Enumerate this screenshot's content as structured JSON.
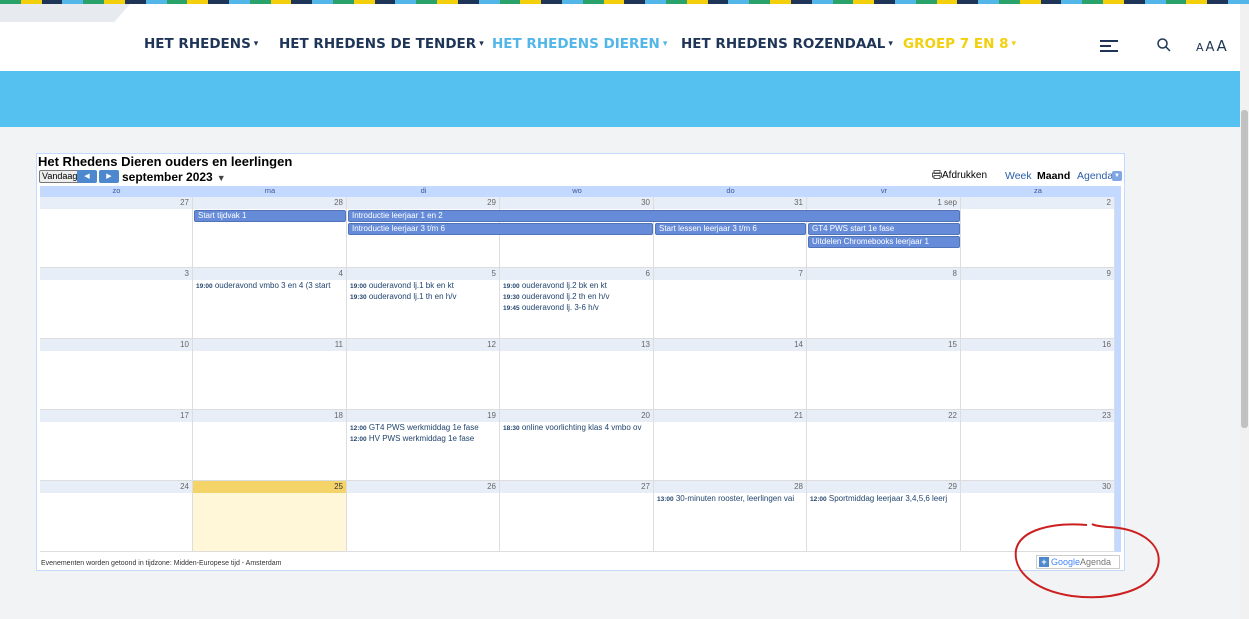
{
  "stripe_colors": [
    "#29a36a",
    "#f4d00c",
    "#1f3557",
    "#52b6e9"
  ],
  "nav": {
    "items": [
      {
        "label": "HET RHEDENS",
        "caret": "▾"
      },
      {
        "label": "HET RHEDENS DE TENDER",
        "caret": "▾"
      },
      {
        "label": "HET RHEDENS DIEREN",
        "caret": "▾"
      },
      {
        "label": "HET RHEDENS ROZENDAAL",
        "caret": "▾"
      },
      {
        "label": "GROEP 7 EN 8",
        "caret": "▾"
      }
    ],
    "active_color": "#52b6e9",
    "aaa": [
      "A",
      "A",
      "A"
    ]
  },
  "banner_color": "#55c1f0",
  "calendar": {
    "title": "Het Rhedens Dieren ouders en leerlingen",
    "today_label": "Vandaag",
    "prev_icon": "◀",
    "next_icon": "▶",
    "month": "september 2023",
    "month_dd": "▼",
    "print_label": "Afdrukken",
    "views": [
      "Week",
      "Maand",
      "Agenda"
    ],
    "selected_view": "Maand",
    "day_names": [
      "zo",
      "ma",
      "di",
      "wo",
      "do",
      "vr",
      "za"
    ],
    "weeks": [
      [
        "27",
        "28",
        "29",
        "30",
        "31",
        "1 sep",
        "2"
      ],
      [
        "3",
        "4",
        "5",
        "6",
        "7",
        "8",
        "9"
      ],
      [
        "10",
        "11",
        "12",
        "13",
        "14",
        "15",
        "16"
      ],
      [
        "17",
        "18",
        "19",
        "20",
        "21",
        "22",
        "23"
      ],
      [
        "24",
        "25",
        "26",
        "27",
        "28",
        "29",
        "30"
      ]
    ],
    "today": "25",
    "multi_day_events": [
      {
        "title": "Start tijdvak 1"
      },
      {
        "title": "Introductie leerjaar 1 en 2"
      },
      {
        "title": "Introductie leerjaar 3 t/m 6"
      },
      {
        "title": "Start lessen leerjaar 3 t/m 6"
      },
      {
        "title": "GT4 PWS start 1e fase"
      },
      {
        "title": "Uitdelen Chromebooks leerjaar 1"
      }
    ],
    "timed_events": [
      {
        "time": "19:00",
        "title": "ouderavond vmbo 3 en 4 (3 start"
      },
      {
        "time": "19:00",
        "title": "ouderavond lj.1 bk en kt"
      },
      {
        "time": "19:30",
        "title": "ouderavond lj.1 th en h/v"
      },
      {
        "time": "19:00",
        "title": "ouderavond lj.2 bk en kt"
      },
      {
        "time": "19:30",
        "title": "ouderavond lj.2 th en h/v"
      },
      {
        "time": "19:45",
        "title": "ouderavond lj. 3-6 h/v"
      },
      {
        "time": "12:00",
        "title": "GT4 PWS werkmiddag 1e fase"
      },
      {
        "time": "12:00",
        "title": "HV PWS werkmiddag 1e fase"
      },
      {
        "time": "18:30",
        "title": "online voorlichting klas 4 vmbo ov"
      },
      {
        "time": "13:00",
        "title": "30-minuten rooster, leerlingen vai"
      },
      {
        "time": "12:00",
        "title": "Sportmiddag leerjaar 3,4,5,6 leerj"
      }
    ],
    "timezone_note": "Evenementen worden getoond in tijdzone: Midden-Europese tijd - Amsterdam",
    "google_badge": {
      "plus": "+",
      "google": "Google",
      "agenda": "Agenda"
    }
  }
}
